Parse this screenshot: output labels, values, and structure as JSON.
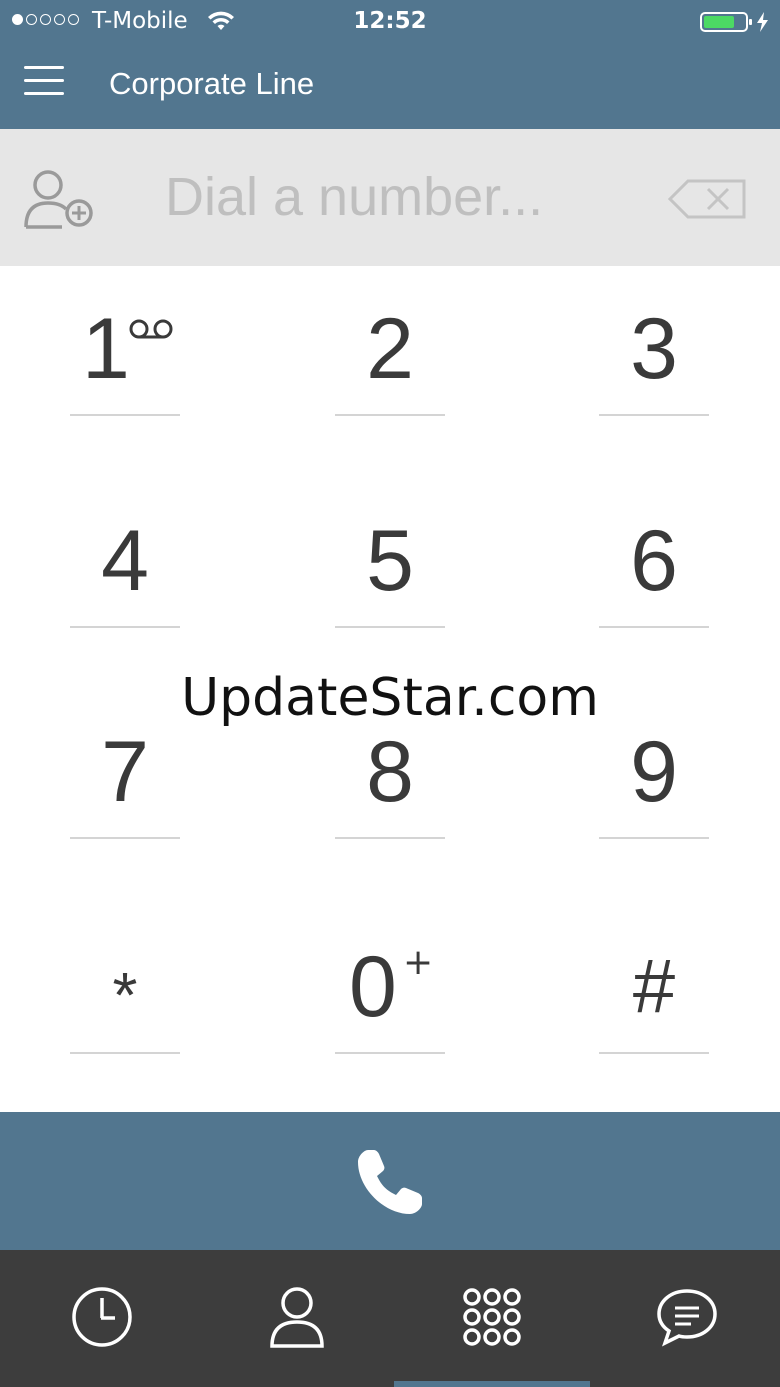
{
  "status_bar": {
    "carrier": "T-Mobile",
    "time": "12:52",
    "signal_bars_filled": 1,
    "signal_bars_total": 5,
    "battery_level": 0.75,
    "battery_color": "#4cd964"
  },
  "header": {
    "title": "Corporate Line"
  },
  "dialer": {
    "placeholder": "Dial a number...",
    "value": ""
  },
  "keypad": {
    "keys": [
      {
        "digit": "1",
        "sup": "voicemail-icon"
      },
      {
        "digit": "2"
      },
      {
        "digit": "3"
      },
      {
        "digit": "4"
      },
      {
        "digit": "5"
      },
      {
        "digit": "6"
      },
      {
        "digit": "7"
      },
      {
        "digit": "8"
      },
      {
        "digit": "9"
      },
      {
        "digit": "*"
      },
      {
        "digit": "0",
        "sup": "+"
      },
      {
        "digit": "#"
      }
    ]
  },
  "watermark": "UpdateStar.com",
  "tabs": [
    {
      "icon": "clock-icon"
    },
    {
      "icon": "contact-icon"
    },
    {
      "icon": "keypad-icon",
      "active": true
    },
    {
      "icon": "chat-icon"
    }
  ],
  "colors": {
    "primary": "#52768f",
    "tabbar": "#3d3d3d",
    "dialbar": "#e6e6e6"
  }
}
